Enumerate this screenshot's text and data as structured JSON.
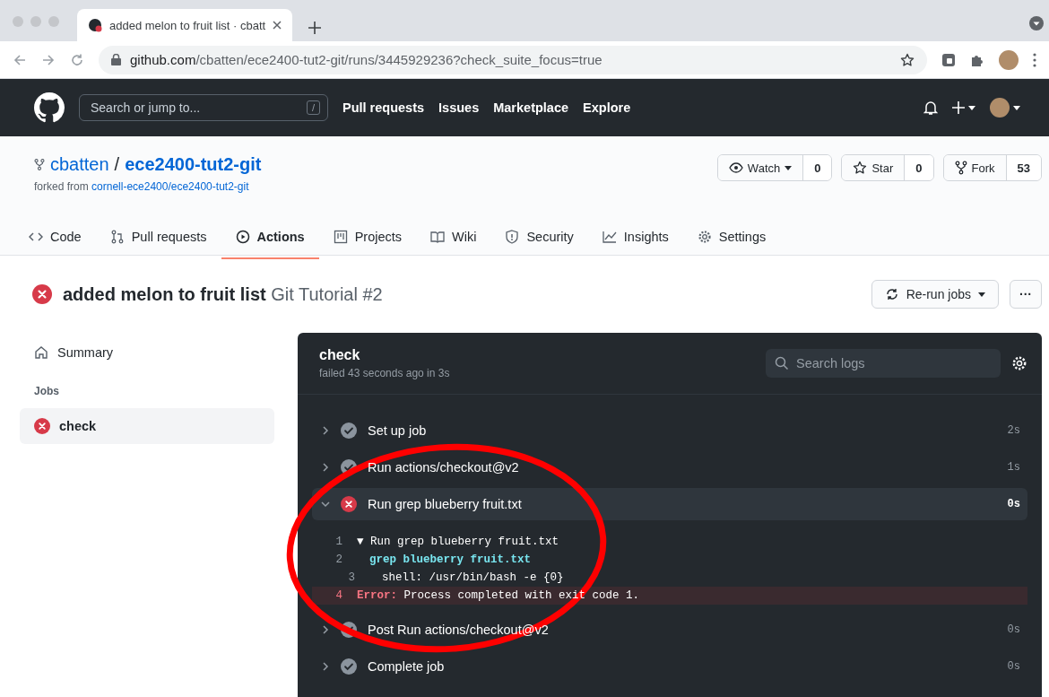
{
  "browser": {
    "tab_title": "added melon to fruit list · cbatt",
    "url_domain": "github.com",
    "url_path": "/cbatten/ece2400-tut2-git/runs/3445929236?check_suite_focus=true"
  },
  "header": {
    "search_placeholder": "Search or jump to...",
    "slash_key": "/",
    "nav": [
      "Pull requests",
      "Issues",
      "Marketplace",
      "Explore"
    ]
  },
  "repo": {
    "owner": "cbatten",
    "separator": "/",
    "name": "ece2400-tut2-git",
    "forked_label": "forked from",
    "forked_link": "cornell-ece2400/ece2400-tut2-git",
    "actions": [
      {
        "kind": "watch",
        "label": "Watch",
        "count": "0"
      },
      {
        "kind": "star",
        "label": "Star",
        "count": "0"
      },
      {
        "kind": "fork",
        "label": "Fork",
        "count": "53"
      }
    ],
    "tabs": [
      {
        "kind": "code",
        "label": "Code",
        "selected": false
      },
      {
        "kind": "pull",
        "label": "Pull requests",
        "selected": false
      },
      {
        "kind": "actions",
        "label": "Actions",
        "selected": true
      },
      {
        "kind": "projects",
        "label": "Projects",
        "selected": false
      },
      {
        "kind": "wiki",
        "label": "Wiki",
        "selected": false
      },
      {
        "kind": "security",
        "label": "Security",
        "selected": false
      },
      {
        "kind": "insights",
        "label": "Insights",
        "selected": false
      },
      {
        "kind": "settings",
        "label": "Settings",
        "selected": false
      }
    ]
  },
  "run": {
    "failed": true,
    "title": "added melon to fruit list",
    "workflow": "Git Tutorial #2",
    "rerun_label": "Re-run jobs",
    "more_label": "···"
  },
  "sidebar": {
    "summary": "Summary",
    "jobs_heading": "Jobs",
    "jobs": [
      {
        "name": "check",
        "failed": true,
        "selected": true
      }
    ]
  },
  "log": {
    "title": "check",
    "subtitle": "failed 43 seconds ago in 3s",
    "search_placeholder": "Search logs",
    "steps": [
      {
        "name": "Set up job",
        "failed": false,
        "expanded": false,
        "duration": "2s"
      },
      {
        "name": "Run actions/checkout@v2",
        "failed": false,
        "expanded": false,
        "duration": "1s"
      },
      {
        "name": "Run grep blueberry fruit.txt",
        "failed": true,
        "expanded": true,
        "duration": "0s",
        "lines": [
          {
            "number": "1",
            "kind": "group",
            "marker": "▼",
            "text": "Run grep blueberry fruit.txt"
          },
          {
            "number": "2",
            "kind": "command",
            "text": "grep blueberry fruit.txt"
          },
          {
            "number": "3",
            "kind": "plain",
            "text": "shell: /usr/bin/bash -e {0}"
          },
          {
            "number": "4",
            "kind": "error",
            "prefix": "Error:",
            "text": "Process completed with exit code 1."
          }
        ]
      },
      {
        "name": "Post Run actions/checkout@v2",
        "failed": false,
        "expanded": false,
        "duration": "0s"
      },
      {
        "name": "Complete job",
        "failed": false,
        "expanded": false,
        "duration": "0s"
      }
    ]
  }
}
